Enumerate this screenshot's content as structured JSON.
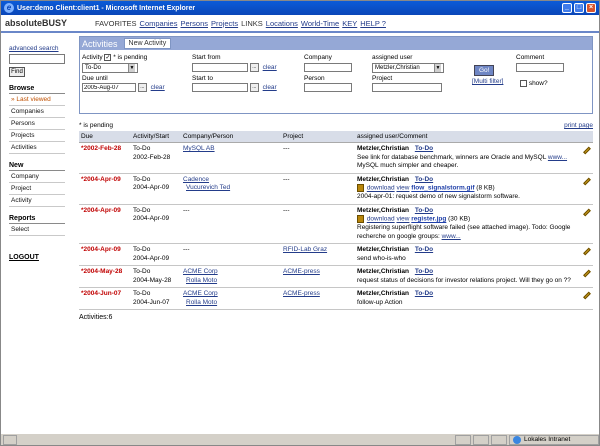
{
  "window": {
    "title": "User:demo Client:client1 - Microsoft Internet Explorer"
  },
  "app": {
    "brand": "absoluteBUSY",
    "nav": [
      {
        "label": "FAVORITES",
        "link": false
      },
      {
        "label": "Companies",
        "link": true
      },
      {
        "label": "Persons",
        "link": true
      },
      {
        "label": "Projects",
        "link": true
      },
      {
        "label": "LINKS",
        "link": false
      },
      {
        "label": "Locations",
        "link": true
      },
      {
        "label": "World-Time",
        "link": true
      },
      {
        "label": "KEY",
        "link": true
      },
      {
        "label": "HELP ?",
        "link": true
      }
    ]
  },
  "sidebar": {
    "advanced_search": "advanced search",
    "find_label": "Find",
    "browse_title": "Browse",
    "browse_items": [
      "» Last viewed",
      "Companies",
      "Persons",
      "Projects",
      "Activities"
    ],
    "new_title": "New",
    "new_items": [
      "Company",
      "Project",
      "Activity"
    ],
    "reports_title": "Reports",
    "reports_items": [
      "Select"
    ],
    "logout": "LOGOUT"
  },
  "panel": {
    "title": "Activities",
    "new_activity": "New Activity"
  },
  "filter": {
    "activity_label": "Activity",
    "pending_label": "* is pending",
    "activity_value": "To-Do",
    "due_until_label": "Due until",
    "due_until_value": "2005-Aug-07",
    "start_from_label": "Start from",
    "start_to_label": "Start to",
    "clear_label": "clear",
    "picker_label": "...",
    "company_label": "Company",
    "person_label": "Person",
    "assigned_label": "assigned user",
    "assigned_value": "Metzler,Christian",
    "project_label": "Project",
    "go_label": "Go!",
    "multi_filter": "[Multi filter]",
    "comment_label": "Comment",
    "show_label": "show?"
  },
  "list": {
    "pending_note": "* is pending",
    "print_page": "print page",
    "headers": [
      "Due",
      "Activity/Start",
      "Company/Person",
      "Project",
      "assigned user/Comment"
    ],
    "rows": [
      {
        "due": "*2002-Feb-28",
        "activity": "To-Do",
        "start": "2002-Feb-28",
        "company": "MySQL AB",
        "person": "",
        "project": "---",
        "user": "Metzler,Christian",
        "status": "To-Do",
        "file": null,
        "comment1": "See link for database benchmark, winners are Oracle and MySQL",
        "comment_link": "www...",
        "comment2": "MySQL much simpler and cheaper."
      },
      {
        "due": "*2004-Apr-09",
        "activity": "To-Do",
        "start": "2004-Apr-09",
        "company": "Cadence",
        "person": "Vucurevich Ted",
        "project": "---",
        "user": "Metzler,Christian",
        "status": "To-Do",
        "file": {
          "download": "download",
          "view": "view",
          "name": "flow_signalstorm.gif",
          "size": "(8 KB)"
        },
        "comment1": "2004-apr-01: request demo of new signalstorm software.",
        "comment_link": "",
        "comment2": ""
      },
      {
        "due": "*2004-Apr-09",
        "activity": "To-Do",
        "start": "2004-Apr-09",
        "company": "---",
        "person": "",
        "project": "---",
        "user": "Metzler,Christian",
        "status": "To-Do",
        "file": {
          "download": "download",
          "view": "view",
          "name": "register.jpg",
          "size": "(30 KB)"
        },
        "comment1": "Registering superflight software failed (see attached image). Todo: Google recherche on google groups:",
        "comment_link": "www...",
        "comment2": ""
      },
      {
        "due": "*2004-Apr-09",
        "activity": "To-Do",
        "start": "2004-Apr-09",
        "company": "---",
        "person": "",
        "project": "RFID-Lab Graz",
        "user": "Metzler,Christian",
        "status": "To-Do",
        "file": null,
        "comment1": "send who-is-who",
        "comment_link": "",
        "comment2": ""
      },
      {
        "due": "*2004-May-28",
        "activity": "To-Do",
        "start": "2004-May-28",
        "company": "ACME Corp",
        "person": "Rolla Moto",
        "project": "ACME-press",
        "user": "Metzler,Christian",
        "status": "To-Do",
        "file": null,
        "comment1": "request status of decisions for investor relations project. Will they go on ??",
        "comment_link": "",
        "comment2": ""
      },
      {
        "due": "*2004-Jun-07",
        "activity": "To-Do",
        "start": "2004-Jun-07",
        "company": "ACME Corp",
        "person": "Rolla Moto",
        "project": "ACME-press",
        "user": "Metzler,Christian",
        "status": "To-Do",
        "file": null,
        "comment1": "follow-up Action",
        "comment_link": "",
        "comment2": ""
      }
    ],
    "count": "Activities:6"
  },
  "statusbar": {
    "zone": "Lokales Intranet"
  },
  "icons": {
    "edit": "pencil-icon",
    "file": "file-icon",
    "browser": "ie-icon"
  }
}
